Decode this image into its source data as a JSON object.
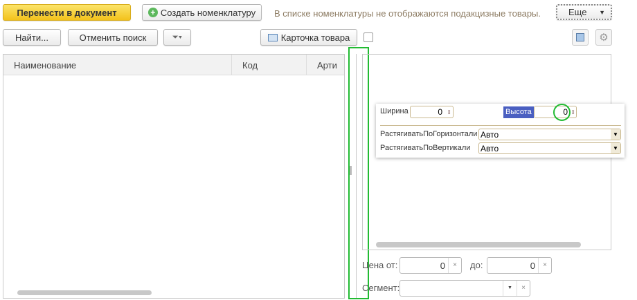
{
  "toolbar": {
    "transfer": "Перенести в документ",
    "create": "Создать номенклатуру",
    "info": "В списке номенклатуры не отображаются подакцизные товары.",
    "more": "Еще"
  },
  "search": {
    "find": "Найти...",
    "cancel": "Отменить поиск",
    "card": "Карточка товара"
  },
  "table": {
    "columns": [
      "Наименование",
      "Код",
      "Арти"
    ]
  },
  "popup": {
    "width_label": "Ширина",
    "width_value": "0",
    "height_label": "Высота",
    "height_value": "0",
    "hstretch_label": "РастягиватьПоГоризонтали",
    "hstretch_value": "Авто",
    "vstretch_label": "РастягиватьПоВертикали",
    "vstretch_value": "Авто"
  },
  "filters": {
    "price_from_label": "Цена от:",
    "price_from": "0",
    "price_to_label": "до:",
    "price_to": "0",
    "segment_label": "Сегмент:",
    "segment": ""
  },
  "colors": {
    "accent": "#f3c21b",
    "highlight": "#22bb33",
    "selected_label": "#4a5fc1"
  }
}
